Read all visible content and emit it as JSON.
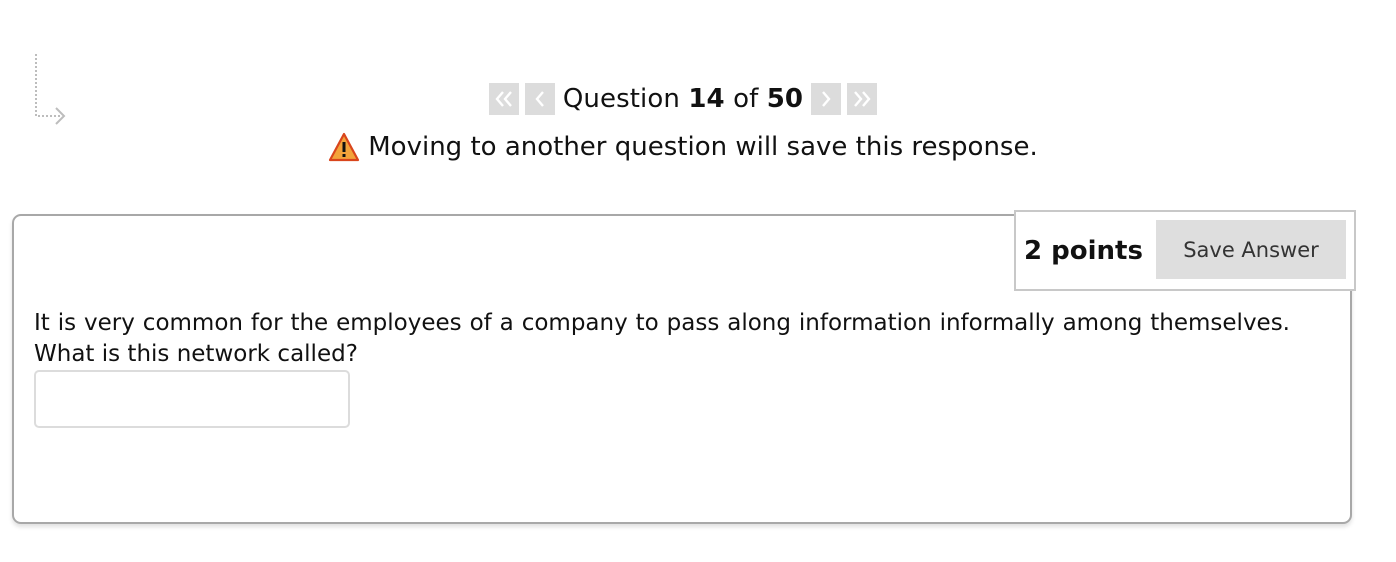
{
  "navigation": {
    "first_icon": "double-chevron-left-icon",
    "prev_icon": "chevron-left-icon",
    "next_icon": "chevron-right-icon",
    "last_icon": "double-chevron-right-icon",
    "question_prefix": "Question",
    "current_question": "14",
    "of_word": "of",
    "total_questions": "50"
  },
  "warning": {
    "icon": "warning-triangle-icon",
    "text": "Moving to another question will save this response."
  },
  "question": {
    "points": "2 points",
    "save_label": "Save Answer",
    "text": "It is very common for the employees of a company to pass along information informally among themselves. What is this network called?",
    "answer_value": "",
    "answer_placeholder": ""
  },
  "colors": {
    "nav_button_bg": "#dcdcdc",
    "warning_orange": "#f3a33a",
    "card_border": "#a8a8a8"
  }
}
